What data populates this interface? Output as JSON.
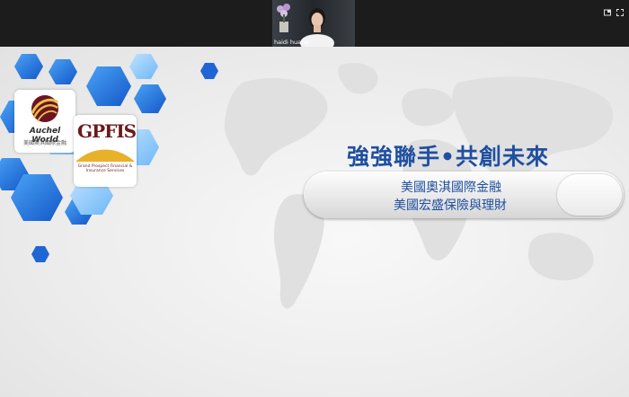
{
  "meeting": {
    "participant_name": "haidi huang"
  },
  "slide": {
    "headline": "強強聯手•共創未來",
    "subtitle_line1": "美國奧淇國際金融",
    "subtitle_line2": "美國宏盛保險與理財",
    "logos": {
      "auchel_name": "Auchel World",
      "auchel_subtitle": "美國奧淇國際金融",
      "gpfis_name": "GPFIS",
      "gpfis_subtitle": "Grand Prospect Financial & Insurance Services"
    }
  },
  "colors": {
    "headline": "#1f4fa0",
    "hex_blue": "#1e6fd8",
    "topbar": "#1c1c1c"
  },
  "icons": [
    "speaker-view-icon",
    "fullscreen-icon"
  ]
}
